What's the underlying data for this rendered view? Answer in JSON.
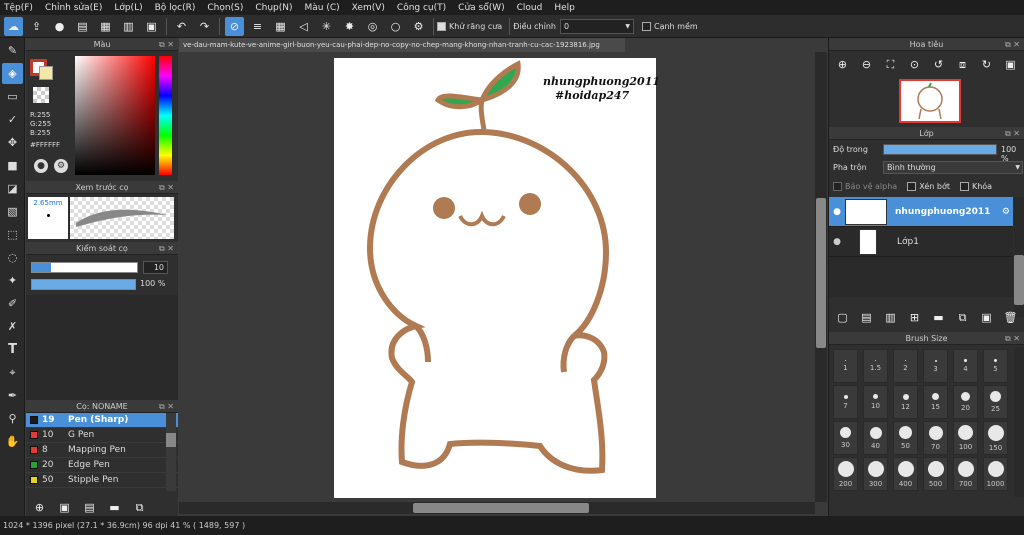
{
  "menu": [
    "Tệp(F)",
    "Chỉnh sửa(E)",
    "Lớp(L)",
    "Bộ lọc(R)",
    "Chọn(S)",
    "Chụp(N)",
    "Màu (C)",
    "Xem(V)",
    "Công cụ(T)",
    "Cửa sổ(W)",
    "Cloud",
    "Help"
  ],
  "toolbar": {
    "antialias_label": "Khử răng cưa",
    "adjust_label": "Điều chỉnh",
    "adjust_value": "0",
    "edge_label": "Cạnh mềm"
  },
  "color_panel": {
    "title": "Màu",
    "r": "R:255",
    "g": "G:255",
    "b": "B:255",
    "hex": "#FFFFFF",
    "foreground": "#c0392b",
    "secondary": "#f1e7a8"
  },
  "brush_preview": {
    "title": "Xem trước cọ",
    "size": "2.65mm"
  },
  "brush_control": {
    "title": "Kiểm soát cọ",
    "size_value": "10",
    "opacity_value": "100 %",
    "size_fraction": 0.18,
    "opacity_fraction": 1.0
  },
  "brush_list": {
    "title": "Cọ: NONAME",
    "items": [
      {
        "size": "19",
        "name": "Pen (Sharp)",
        "color": "#1a1a1a"
      },
      {
        "size": "10",
        "name": "G Pen",
        "color": "#e53935"
      },
      {
        "size": "8",
        "name": "Mapping Pen",
        "color": "#e53935"
      },
      {
        "size": "20",
        "name": "Edge Pen",
        "color": "#2e9e3a"
      },
      {
        "size": "50",
        "name": "Stipple Pen",
        "color": "#e6d51e"
      }
    ]
  },
  "document": {
    "tab_title": "ve-dau-mam-kute-ve-anime-girl-buon-yeu-cau-phai-dep-no-copy-no-chep-mang-khong-nhan-tranh-cu-cac-1923816.jpg",
    "watermark_line1": "nhungphuong2011",
    "watermark_line2": "#hoidap247",
    "stroke_color": "#b07a52",
    "sprout_color": "#2fa84f"
  },
  "navigator": {
    "title": "Hoa tiêu"
  },
  "layer_panel": {
    "title": "Lớp",
    "opacity_label": "Độ trong",
    "opacity_value": "100 %",
    "opacity_fraction": 1.0,
    "blend_label": "Pha trộn",
    "blend_value": "Bình thường",
    "protect_alpha": "Bảo vệ alpha",
    "clipping": "Xén bớt",
    "lock": "Khóa",
    "layers": [
      {
        "name": "nhungphuong2011",
        "selected": true
      },
      {
        "name": "Lớp1",
        "selected": false
      }
    ]
  },
  "brush_size": {
    "title": "Brush Size",
    "sizes": [
      "1",
      "1.5",
      "2",
      "3",
      "4",
      "5",
      "7",
      "10",
      "12",
      "15",
      "20",
      "25",
      "30",
      "40",
      "50",
      "70",
      "100",
      "150",
      "200",
      "300",
      "400",
      "500",
      "700",
      "1000"
    ]
  },
  "status": {
    "text": "1024 * 1396 pixel  (27.1 * 36.9cm)  96 dpi  41 %  ( 1489, 597 )"
  }
}
